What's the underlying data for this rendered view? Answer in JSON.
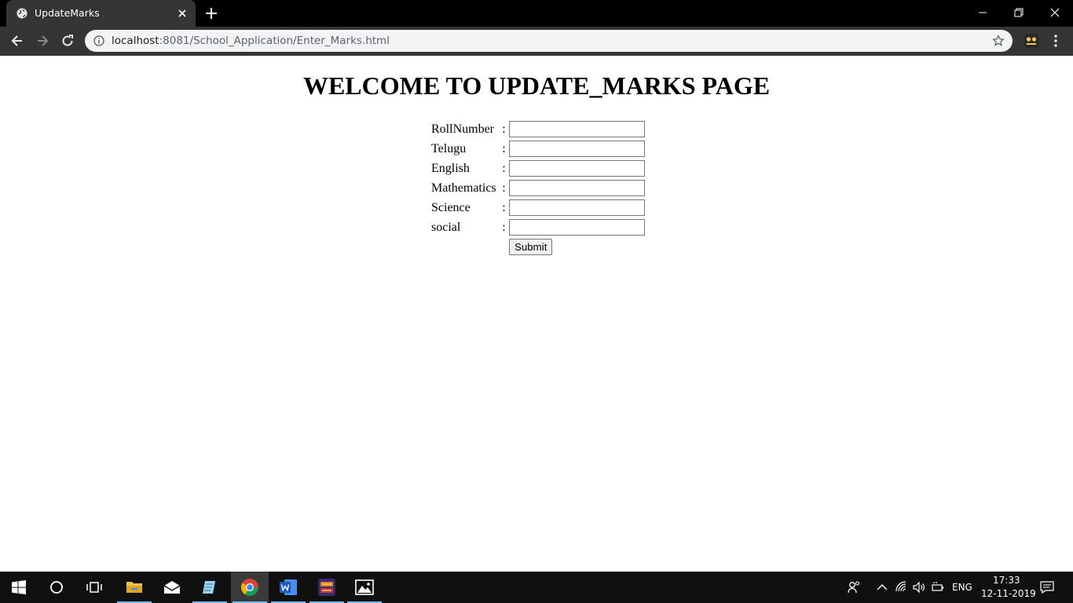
{
  "browser": {
    "tab_title": "UpdateMarks",
    "url_host": "localhost",
    "url_rest": ":8081/School_Application/Enter_Marks.html"
  },
  "page": {
    "title": "WELCOME TO UPDATE_MARKS PAGE",
    "fields": [
      {
        "label": "RollNumber",
        "value": ""
      },
      {
        "label": "Telugu",
        "value": ""
      },
      {
        "label": "English",
        "value": ""
      },
      {
        "label": "Mathematics",
        "value": ""
      },
      {
        "label": "Science",
        "value": ""
      },
      {
        "label": "social",
        "value": ""
      }
    ],
    "separator": ":",
    "submit_label": "Submit"
  },
  "taskbar": {
    "apps": [
      "start-icon",
      "search-circle-icon",
      "task-view-icon",
      "file-explorer-icon",
      "mail-icon",
      "notepad-icon",
      "chrome-icon",
      "word-icon",
      "game-icon",
      "photos-icon"
    ],
    "language": "ENG",
    "time": "17:33",
    "date": "12-11-2019"
  },
  "colors": {
    "chrome_dark": "#353535",
    "titlebar": "#000000",
    "taskbar": "#101010",
    "accent": "#76b9ed"
  }
}
